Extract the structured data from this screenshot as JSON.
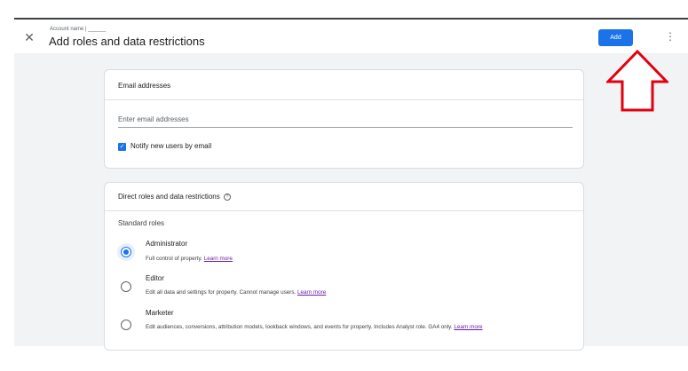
{
  "header": {
    "close_label": "✕",
    "account_label": "Account name | ______",
    "title": "Add roles and data restrictions",
    "add_button": "Add",
    "more_label": "⋮"
  },
  "email_card": {
    "title": "Email addresses",
    "input_placeholder": "Enter email addresses",
    "notify_label": "Notify new users by email",
    "notify_checked": true
  },
  "roles_card": {
    "title": "Direct roles and data restrictions",
    "help_icon": "?",
    "section_label": "Standard roles",
    "roles": [
      {
        "name": "Administrator",
        "desc": "Full control of property.",
        "learn": "Learn more",
        "selected": true
      },
      {
        "name": "Editor",
        "desc": "Edit all data and settings for property. Cannot manage users.",
        "learn": "Learn more",
        "selected": false
      },
      {
        "name": "Marketer",
        "desc": "Edit audiences, conversions, attribution models, lookback windows, and events for property. Includes Analyst role. GA4 only.",
        "learn": "Learn more",
        "selected": false
      }
    ]
  },
  "colors": {
    "accent": "#1a73e8",
    "arrow": "#e3000f",
    "link": "#681da8"
  }
}
